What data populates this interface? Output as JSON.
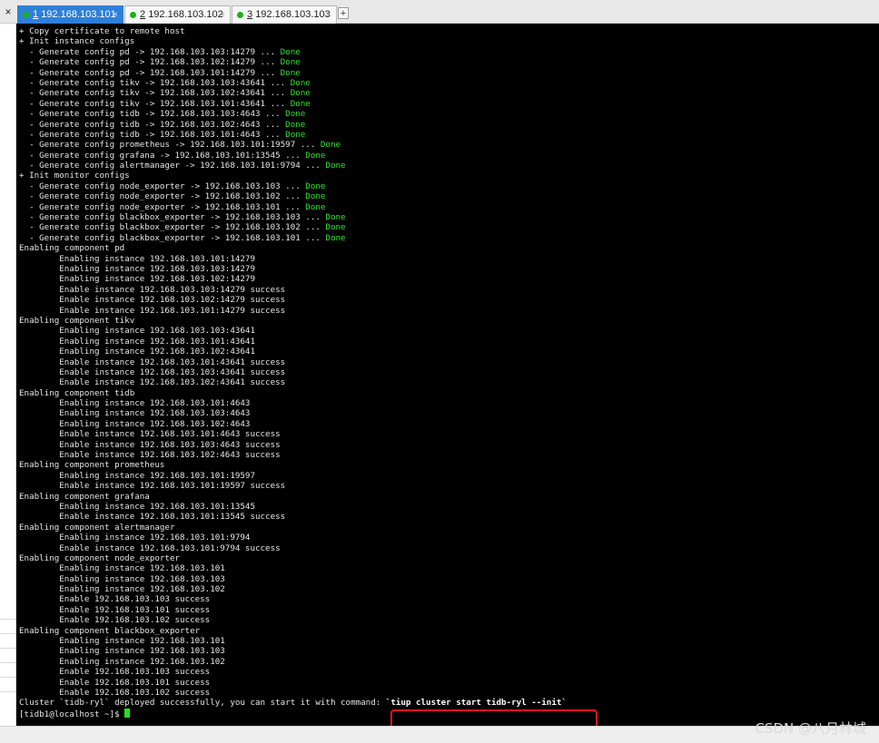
{
  "tabs": [
    {
      "num": "1",
      "host": "192.168.103.101",
      "close": "×",
      "active": true
    },
    {
      "num": "2",
      "host": "192.168.103.102",
      "close": "×",
      "active": false
    },
    {
      "num": "3",
      "host": "192.168.103.103",
      "close": "×",
      "active": false
    }
  ],
  "tabbar": {
    "close_all": "×",
    "new_tab": "+"
  },
  "terminal": {
    "lines": [
      {
        "text": "+ Copy certificate to remote host"
      },
      {
        "text": "+ Init instance configs"
      },
      {
        "text": "  - Generate config pd -> 192.168.103.103:14279 ... ",
        "status": "Done"
      },
      {
        "text": "  - Generate config pd -> 192.168.103.102:14279 ... ",
        "status": "Done"
      },
      {
        "text": "  - Generate config pd -> 192.168.103.101:14279 ... ",
        "status": "Done"
      },
      {
        "text": "  - Generate config tikv -> 192.168.103.103:43641 ... ",
        "status": "Done"
      },
      {
        "text": "  - Generate config tikv -> 192.168.103.102:43641 ... ",
        "status": "Done"
      },
      {
        "text": "  - Generate config tikv -> 192.168.103.101:43641 ... ",
        "status": "Done"
      },
      {
        "text": "  - Generate config tidb -> 192.168.103.103:4643 ... ",
        "status": "Done"
      },
      {
        "text": "  - Generate config tidb -> 192.168.103.102:4643 ... ",
        "status": "Done"
      },
      {
        "text": "  - Generate config tidb -> 192.168.103.101:4643 ... ",
        "status": "Done"
      },
      {
        "text": "  - Generate config prometheus -> 192.168.103.101:19597 ... ",
        "status": "Done"
      },
      {
        "text": "  - Generate config grafana -> 192.168.103.101:13545 ... ",
        "status": "Done"
      },
      {
        "text": "  - Generate config alertmanager -> 192.168.103.101:9794 ... ",
        "status": "Done"
      },
      {
        "text": "+ Init monitor configs"
      },
      {
        "text": "  - Generate config node_exporter -> 192.168.103.103 ... ",
        "status": "Done"
      },
      {
        "text": "  - Generate config node_exporter -> 192.168.103.102 ... ",
        "status": "Done"
      },
      {
        "text": "  - Generate config node_exporter -> 192.168.103.101 ... ",
        "status": "Done"
      },
      {
        "text": "  - Generate config blackbox_exporter -> 192.168.103.103 ... ",
        "status": "Done"
      },
      {
        "text": "  - Generate config blackbox_exporter -> 192.168.103.102 ... ",
        "status": "Done"
      },
      {
        "text": "  - Generate config blackbox_exporter -> 192.168.103.101 ... ",
        "status": "Done"
      },
      {
        "text": "Enabling component pd"
      },
      {
        "text": "        Enabling instance 192.168.103.101:14279"
      },
      {
        "text": "        Enabling instance 192.168.103.103:14279"
      },
      {
        "text": "        Enabling instance 192.168.103.102:14279"
      },
      {
        "text": "        Enable instance 192.168.103.103:14279 success"
      },
      {
        "text": "        Enable instance 192.168.103.102:14279 success"
      },
      {
        "text": "        Enable instance 192.168.103.101:14279 success"
      },
      {
        "text": "Enabling component tikv"
      },
      {
        "text": "        Enabling instance 192.168.103.103:43641"
      },
      {
        "text": "        Enabling instance 192.168.103.101:43641"
      },
      {
        "text": "        Enabling instance 192.168.103.102:43641"
      },
      {
        "text": "        Enable instance 192.168.103.101:43641 success"
      },
      {
        "text": "        Enable instance 192.168.103.103:43641 success"
      },
      {
        "text": "        Enable instance 192.168.103.102:43641 success"
      },
      {
        "text": "Enabling component tidb"
      },
      {
        "text": "        Enabling instance 192.168.103.101:4643"
      },
      {
        "text": "        Enabling instance 192.168.103.103:4643"
      },
      {
        "text": "        Enabling instance 192.168.103.102:4643"
      },
      {
        "text": "        Enable instance 192.168.103.101:4643 success"
      },
      {
        "text": "        Enable instance 192.168.103.103:4643 success"
      },
      {
        "text": "        Enable instance 192.168.103.102:4643 success"
      },
      {
        "text": "Enabling component prometheus"
      },
      {
        "text": "        Enabling instance 192.168.103.101:19597"
      },
      {
        "text": "        Enable instance 192.168.103.101:19597 success"
      },
      {
        "text": "Enabling component grafana"
      },
      {
        "text": "        Enabling instance 192.168.103.101:13545"
      },
      {
        "text": "        Enable instance 192.168.103.101:13545 success"
      },
      {
        "text": "Enabling component alertmanager"
      },
      {
        "text": "        Enabling instance 192.168.103.101:9794"
      },
      {
        "text": "        Enable instance 192.168.103.101:9794 success"
      },
      {
        "text": "Enabling component node_exporter"
      },
      {
        "text": "        Enabling instance 192.168.103.101"
      },
      {
        "text": "        Enabling instance 192.168.103.103"
      },
      {
        "text": "        Enabling instance 192.168.103.102"
      },
      {
        "text": "        Enable 192.168.103.103 success"
      },
      {
        "text": "        Enable 192.168.103.101 success"
      },
      {
        "text": "        Enable 192.168.103.102 success"
      },
      {
        "text": "Enabling component blackbox_exporter"
      },
      {
        "text": "        Enabling instance 192.168.103.101"
      },
      {
        "text": "        Enabling instance 192.168.103.103"
      },
      {
        "text": "        Enabling instance 192.168.103.102"
      },
      {
        "text": "        Enable 192.168.103.103 success"
      },
      {
        "text": "        Enable 192.168.103.101 success"
      },
      {
        "text": "        Enable 192.168.103.102 success"
      },
      {
        "text": "Cluster `tidb-ryl` deployed successfully, you can start it with command: ",
        "cmd": "`tiup cluster start tidb-ryl --init`"
      }
    ],
    "prompt": "[tidb1@localhost ~]$ "
  },
  "watermark": "CSDN @八月林城",
  "colors": {
    "done": "#2fe02f",
    "active_tab": "#2f7fd8",
    "highlight": "#e8141c",
    "cursor": "#22e022"
  }
}
